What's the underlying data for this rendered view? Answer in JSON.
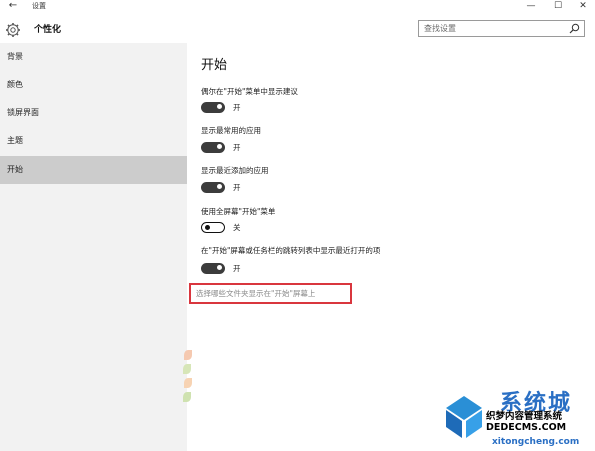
{
  "window": {
    "back_glyph": "←",
    "title": "设置",
    "controls": {
      "minimize": "—",
      "maximize": "☐",
      "close": "✕"
    }
  },
  "header": {
    "section_title": "个性化",
    "search_placeholder": "查找设置"
  },
  "sidebar": {
    "items": [
      {
        "label": "背景",
        "selected": false
      },
      {
        "label": "颜色",
        "selected": false
      },
      {
        "label": "锁屏界面",
        "selected": false
      },
      {
        "label": "主题",
        "selected": false
      },
      {
        "label": "开始",
        "selected": true
      }
    ]
  },
  "main": {
    "heading": "开始",
    "settings": [
      {
        "label": "偶尔在\"开始\"菜单中显示建议",
        "state": "开",
        "on": true
      },
      {
        "label": "显示最常用的应用",
        "state": "开",
        "on": true
      },
      {
        "label": "显示最近添加的应用",
        "state": "开",
        "on": true
      },
      {
        "label": "使用全屏幕\"开始\"菜单",
        "state": "关",
        "on": false
      },
      {
        "label": "在\"开始\"屏幕或任务栏的跳转列表中显示最近打开的项",
        "state": "开",
        "on": true
      }
    ],
    "link": "选择哪些文件夹显示在\"开始\"屏幕上"
  },
  "watermark": {
    "brand_cn": "系统城",
    "domain": "xitongcheng.com",
    "overlay_line1": "织梦内容管理系统",
    "overlay_line2": "DEDECMS.COM"
  },
  "colors": {
    "sidebar_bg": "#f2f2f2",
    "selected_item_bg": "#cccccc",
    "toggle_on": "#3c3c3c",
    "highlight_border": "#d9363e",
    "watermark_blue": "#2a6fc4"
  }
}
